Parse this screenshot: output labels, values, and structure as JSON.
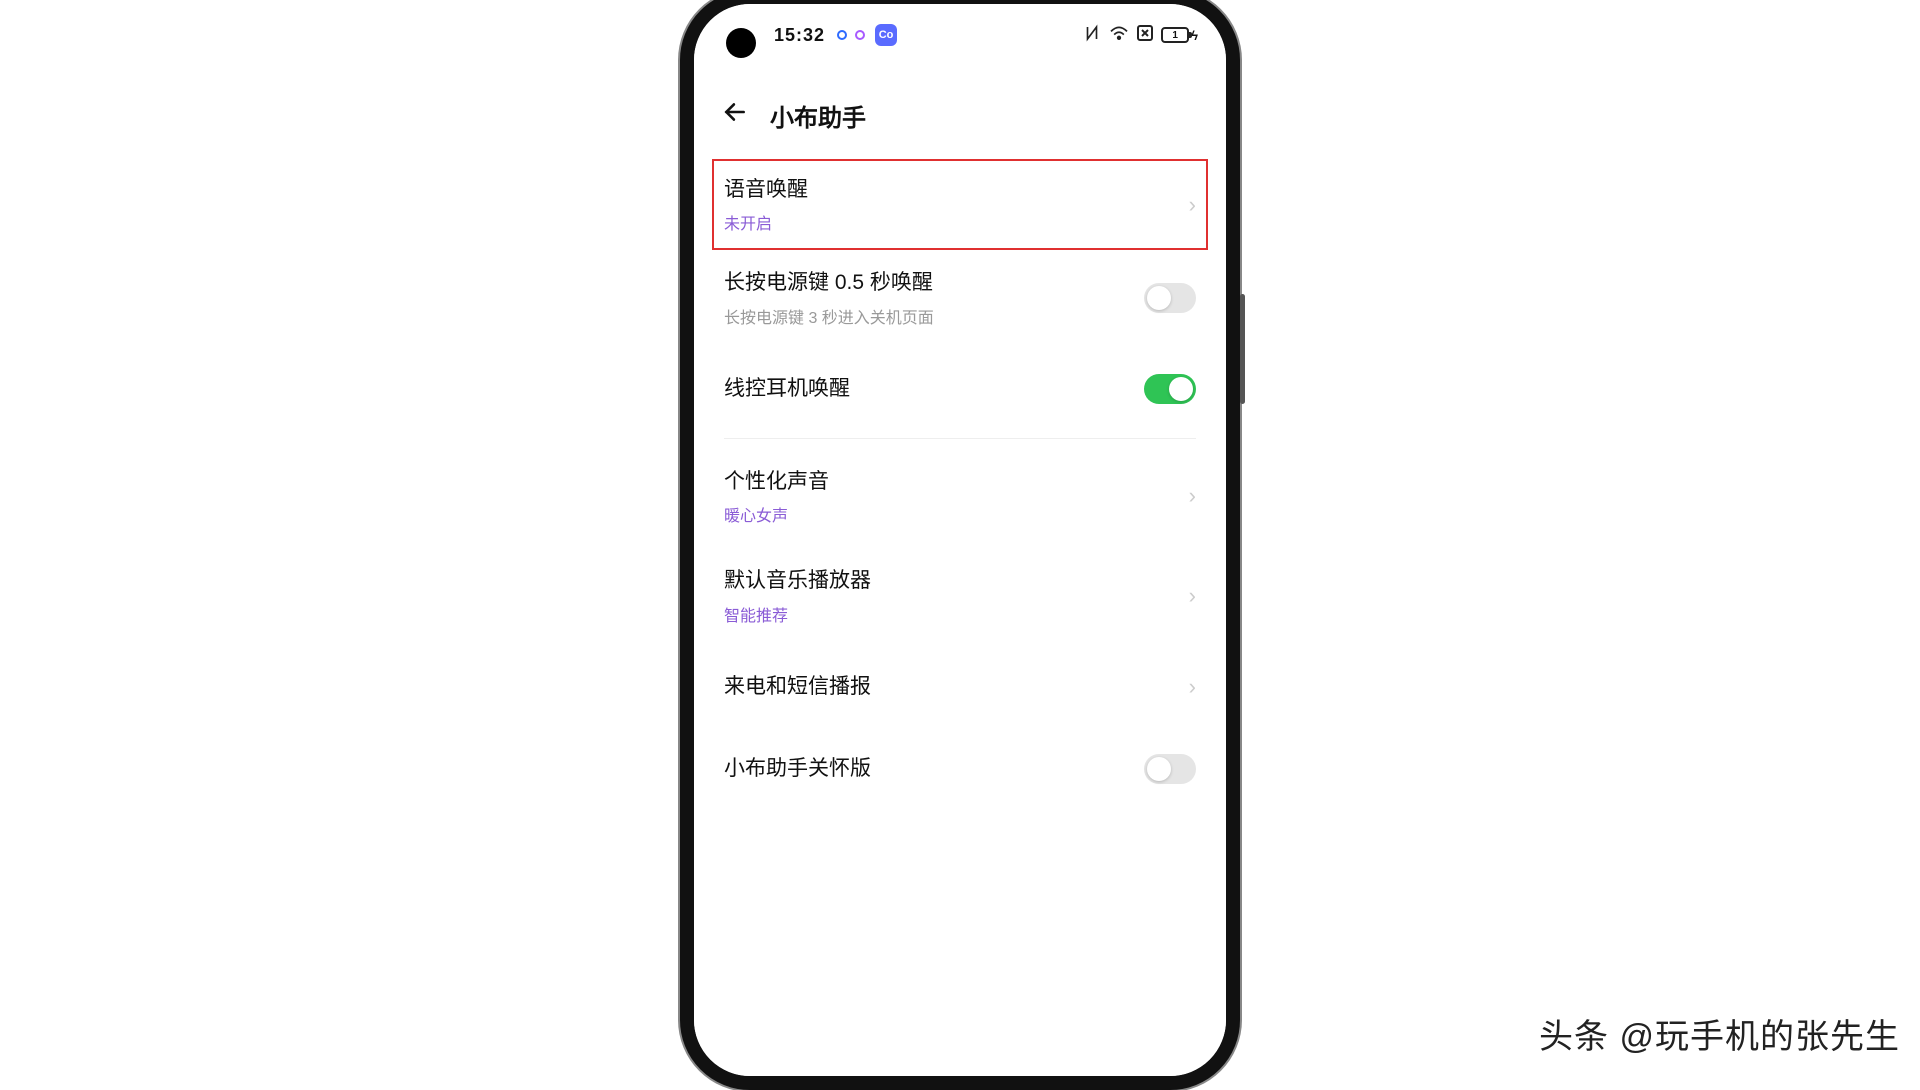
{
  "status_bar": {
    "time": "15:32",
    "app_badge": "Co",
    "battery_level": "1",
    "bolt": "⚡"
  },
  "header": {
    "title": "小布助手"
  },
  "items": {
    "voice_wake": {
      "title": "语音唤醒",
      "sub": "未开启"
    },
    "power_wake": {
      "title": "长按电源键 0.5 秒唤醒",
      "sub": "长按电源键 3 秒进入关机页面"
    },
    "wired_headset": {
      "title": "线控耳机唤醒"
    },
    "voice_custom": {
      "title": "个性化声音",
      "sub": "暖心女声"
    },
    "music_player": {
      "title": "默认音乐播放器",
      "sub": "智能推荐"
    },
    "call_sms": {
      "title": "来电和短信播报"
    },
    "care_mode": {
      "title": "小布助手关怀版"
    }
  },
  "watermark": "头条 @玩手机的张先生"
}
